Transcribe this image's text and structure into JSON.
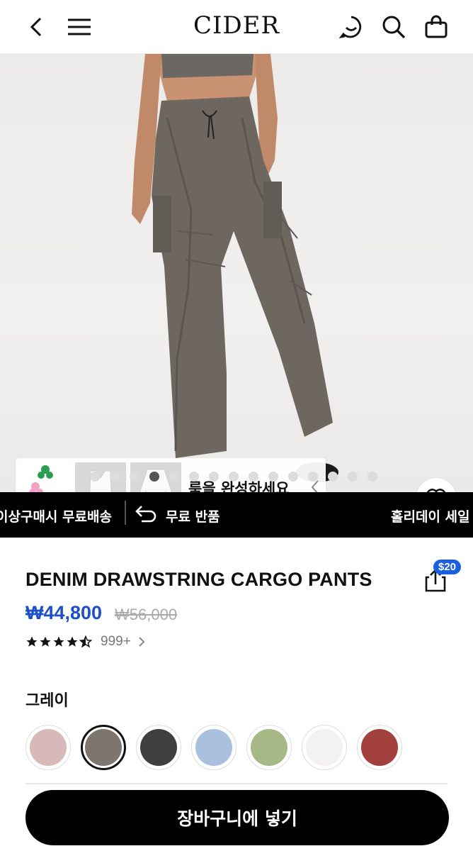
{
  "header": {
    "logo": "CIDER",
    "back_icon": "chevron-left-icon",
    "menu_icon": "hamburger-menu-icon",
    "chat_icon": "chat-smile-icon",
    "search_icon": "search-icon",
    "cart_icon": "shopping-bag-icon"
  },
  "gallery": {
    "total_images": 15,
    "current_index": 4,
    "complete_look_label": "룩을 완성하세요",
    "wishlist_icon": "heart-icon"
  },
  "banner": {
    "items": [
      "이상구매시 무료배송",
      "무료 반품",
      "홀리데이 세일"
    ],
    "return_icon": "return-arrow-icon"
  },
  "product": {
    "title": "DENIM DRAWSTRING CARGO PANTS",
    "price": "₩44,800",
    "original_price": "₩56,000",
    "rating": 4.5,
    "review_count": "999+",
    "share_badge": "$20",
    "share_icon": "share-icon"
  },
  "color": {
    "selected_label": "그레이",
    "swatches": [
      "#d8b9b9",
      "#7d766f",
      "#3e3f3e",
      "#a9c0de",
      "#a6b886",
      "#f4f1f3",
      "#a2403e"
    ],
    "selected_index": 1
  },
  "actions": {
    "add_to_cart": "장바구니에 넣기"
  }
}
